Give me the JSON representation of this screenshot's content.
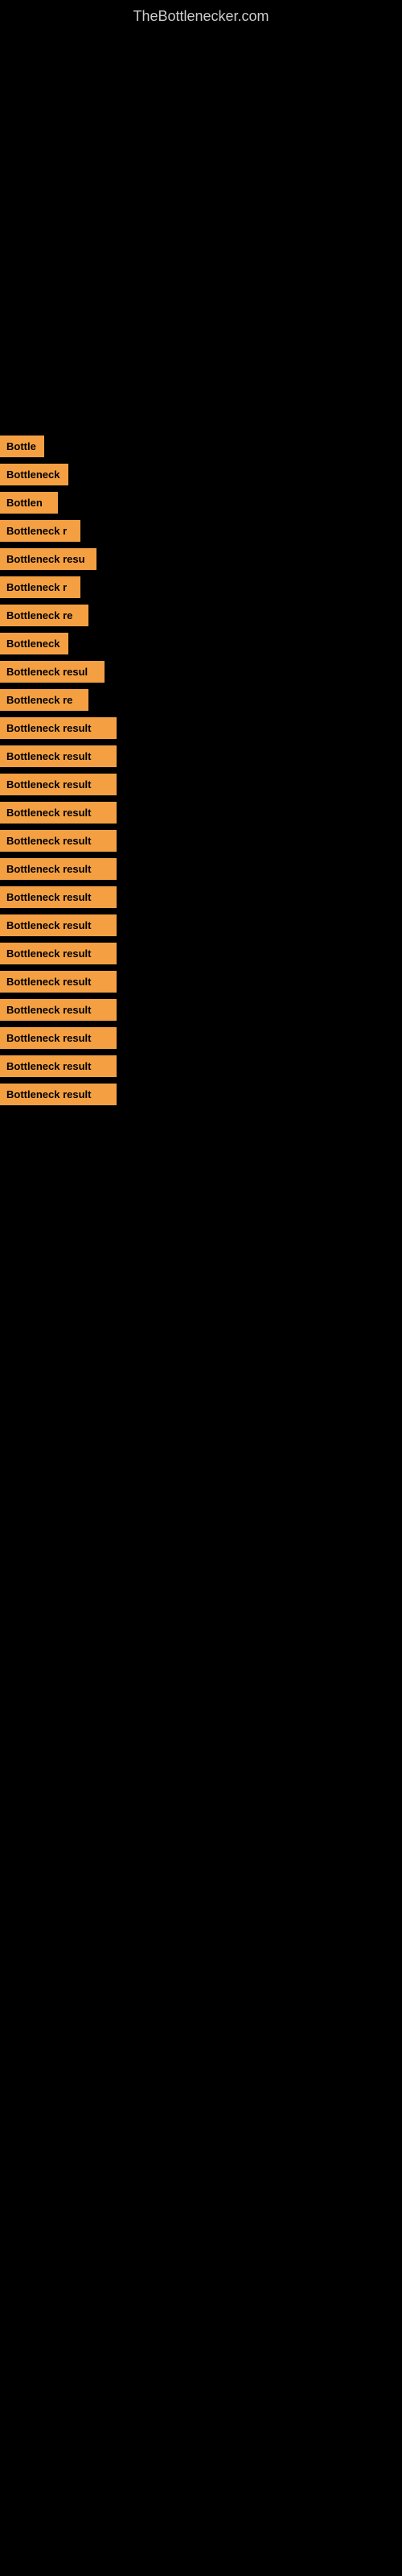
{
  "site": {
    "title": "TheBottlenecker.com"
  },
  "results": [
    {
      "label": "Bottle",
      "width": 55
    },
    {
      "label": "Bottleneck",
      "width": 85
    },
    {
      "label": "Bottlen",
      "width": 72
    },
    {
      "label": "Bottleneck r",
      "width": 100
    },
    {
      "label": "Bottleneck resu",
      "width": 120
    },
    {
      "label": "Bottleneck r",
      "width": 100
    },
    {
      "label": "Bottleneck re",
      "width": 110
    },
    {
      "label": "Bottleneck",
      "width": 85
    },
    {
      "label": "Bottleneck resul",
      "width": 130
    },
    {
      "label": "Bottleneck re",
      "width": 110
    },
    {
      "label": "Bottleneck result",
      "width": 145
    },
    {
      "label": "Bottleneck result",
      "width": 145
    },
    {
      "label": "Bottleneck result",
      "width": 145
    },
    {
      "label": "Bottleneck result",
      "width": 145
    },
    {
      "label": "Bottleneck result",
      "width": 145
    },
    {
      "label": "Bottleneck result",
      "width": 145
    },
    {
      "label": "Bottleneck result",
      "width": 145
    },
    {
      "label": "Bottleneck result",
      "width": 145
    },
    {
      "label": "Bottleneck result",
      "width": 145
    },
    {
      "label": "Bottleneck result",
      "width": 145
    },
    {
      "label": "Bottleneck result",
      "width": 145
    },
    {
      "label": "Bottleneck result",
      "width": 145
    },
    {
      "label": "Bottleneck result",
      "width": 145
    },
    {
      "label": "Bottleneck result",
      "width": 145
    }
  ]
}
